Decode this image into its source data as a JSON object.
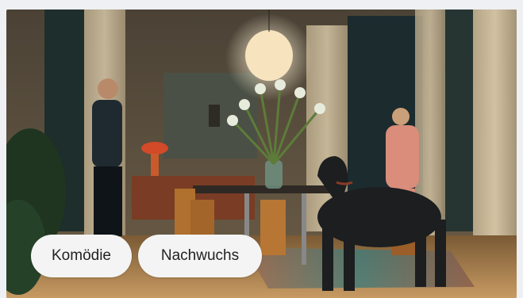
{
  "tags": [
    {
      "label": "Komödie"
    },
    {
      "label": "Nachwuchs"
    }
  ],
  "colors": {
    "page_background": "#eef0f3",
    "tag_background": "#f4f4f4",
    "tag_text": "#222222"
  },
  "image": {
    "icon": "movie-still-image"
  }
}
